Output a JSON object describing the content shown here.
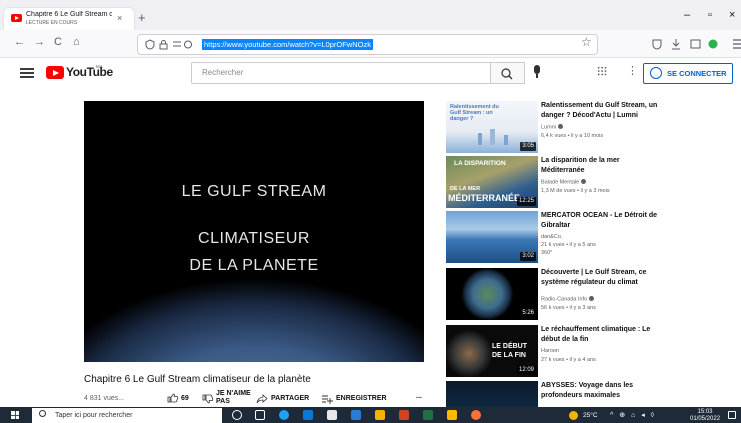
{
  "browser": {
    "tab_title": "Chapitre 6 Le Gulf Stream clima",
    "tab_subtitle": "LECTURE EN COURS",
    "tab_close": "×",
    "new_tab": "+",
    "url": "https://www.youtube.com/watch?v=L0prOFwNOzk",
    "window_controls": {
      "minimize": "–",
      "maximize": "▫",
      "close": "×"
    },
    "nav_icons": {
      "back": "←",
      "forward": "→",
      "reload": "C",
      "home": "⌂",
      "bookmark": "☆"
    }
  },
  "youtube": {
    "logo_text": "YouTube",
    "logo_country": "MA",
    "search_placeholder": "Rechercher",
    "more_menu": "⋮",
    "sign_in": "SE CONNECTER",
    "brand_color": "#ff0000",
    "link_color": "#065fd4"
  },
  "video": {
    "overlay_line1": "LE GULF STREAM",
    "overlay_line2": "CLIMATISEUR",
    "overlay_line3": "DE LA PLANETE",
    "title": "Chapitre 6 Le Gulf Stream climatiseur de la planète",
    "views": "4 831 vues...",
    "likes": "69",
    "dislike_label_1": "JE N'AIME",
    "dislike_label_2": "PAS",
    "share_label": "PARTAGER",
    "save_label": "ENREGISTRER",
    "more": "..."
  },
  "related": [
    {
      "title": "Ralentissement du Gulf Stream, un danger ? Décod'Actu | Lumni",
      "channel": "Lumni",
      "meta": "6,4 k vues • il y a 10 mois",
      "duration": "3:05",
      "thumb_text": "Ralentissement du Gulf Stream : un danger ?"
    },
    {
      "title": "La disparition de la mer Méditerranée",
      "channel": "Balade Mentale",
      "meta": "1,3 M de vues • il y a 3 mois",
      "duration": "12:25",
      "thumb_text_1": "LA DISPARITION",
      "thumb_text_2": "DE LA MER",
      "thumb_text_3": "MÉDITERRANÉE"
    },
    {
      "title": "MERCATOR OCEAN - Le Détroit de Gibraltar",
      "channel": "dan&Co.",
      "meta": "21 k vues • il y a 5 ans",
      "badge": "360°",
      "duration": "3:02"
    },
    {
      "title": "Découverte | Le Gulf Stream, ce système régulateur du climat",
      "channel": "Radio-Canada Info",
      "meta": "56 k vues • il y a 3 ans",
      "duration": "5:26"
    },
    {
      "title": "Le réchauffement climatique : Le début de la fin",
      "channel": "Haroon",
      "meta": "27 k vues • il y a 4 ans",
      "duration": "12:09",
      "thumb_text_1": "LE DÉBUT",
      "thumb_text_2": "DE LA FIN"
    },
    {
      "title": "ABYSSES: Voyage dans les profondeurs maximales"
    }
  ],
  "taskbar": {
    "search_text": "Taper ici pour rechercher",
    "temperature": "25°C",
    "tray": "^ ⊕ ⌂ ◂ ◊",
    "time": "15:03",
    "date": "01/05/2022"
  }
}
